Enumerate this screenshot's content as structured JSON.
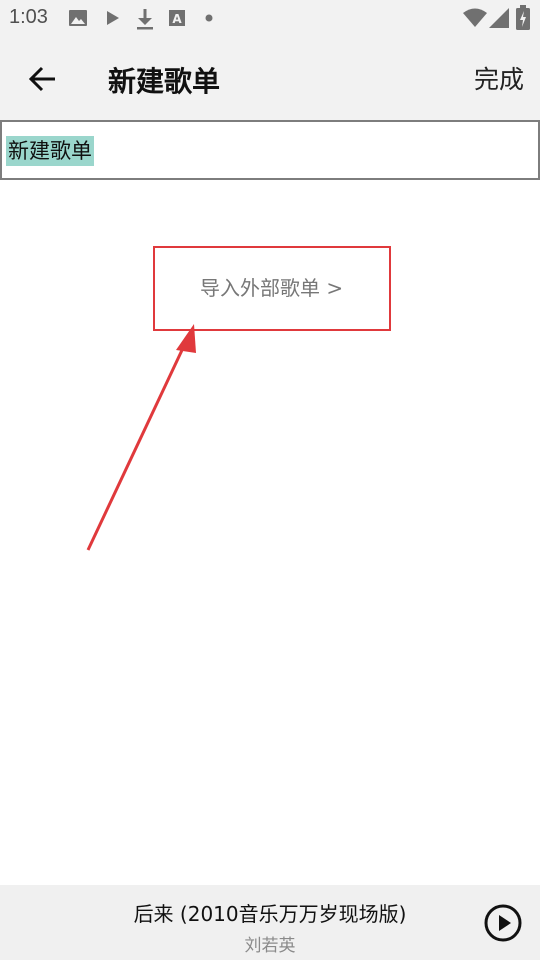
{
  "status_bar": {
    "time": "1:03",
    "left_icons": [
      "image-icon",
      "play-store-icon",
      "download-icon",
      "font-icon",
      "dot-icon"
    ],
    "right_icons": [
      "wifi-icon",
      "signal-icon",
      "battery-icon"
    ]
  },
  "header": {
    "back_icon": "arrow-left-icon",
    "title": "新建歌单",
    "done_label": "完成"
  },
  "name_field": {
    "value": "新建歌单",
    "selected": true,
    "selection_color": "#9ad6cc"
  },
  "import": {
    "label": "导入外部歌单 >"
  },
  "annotation": {
    "color": "#e0393c"
  },
  "player": {
    "song_title": "后来 (2010音乐万万岁现场版)",
    "artist": "刘若英",
    "play_icon": "play-circle-icon"
  }
}
